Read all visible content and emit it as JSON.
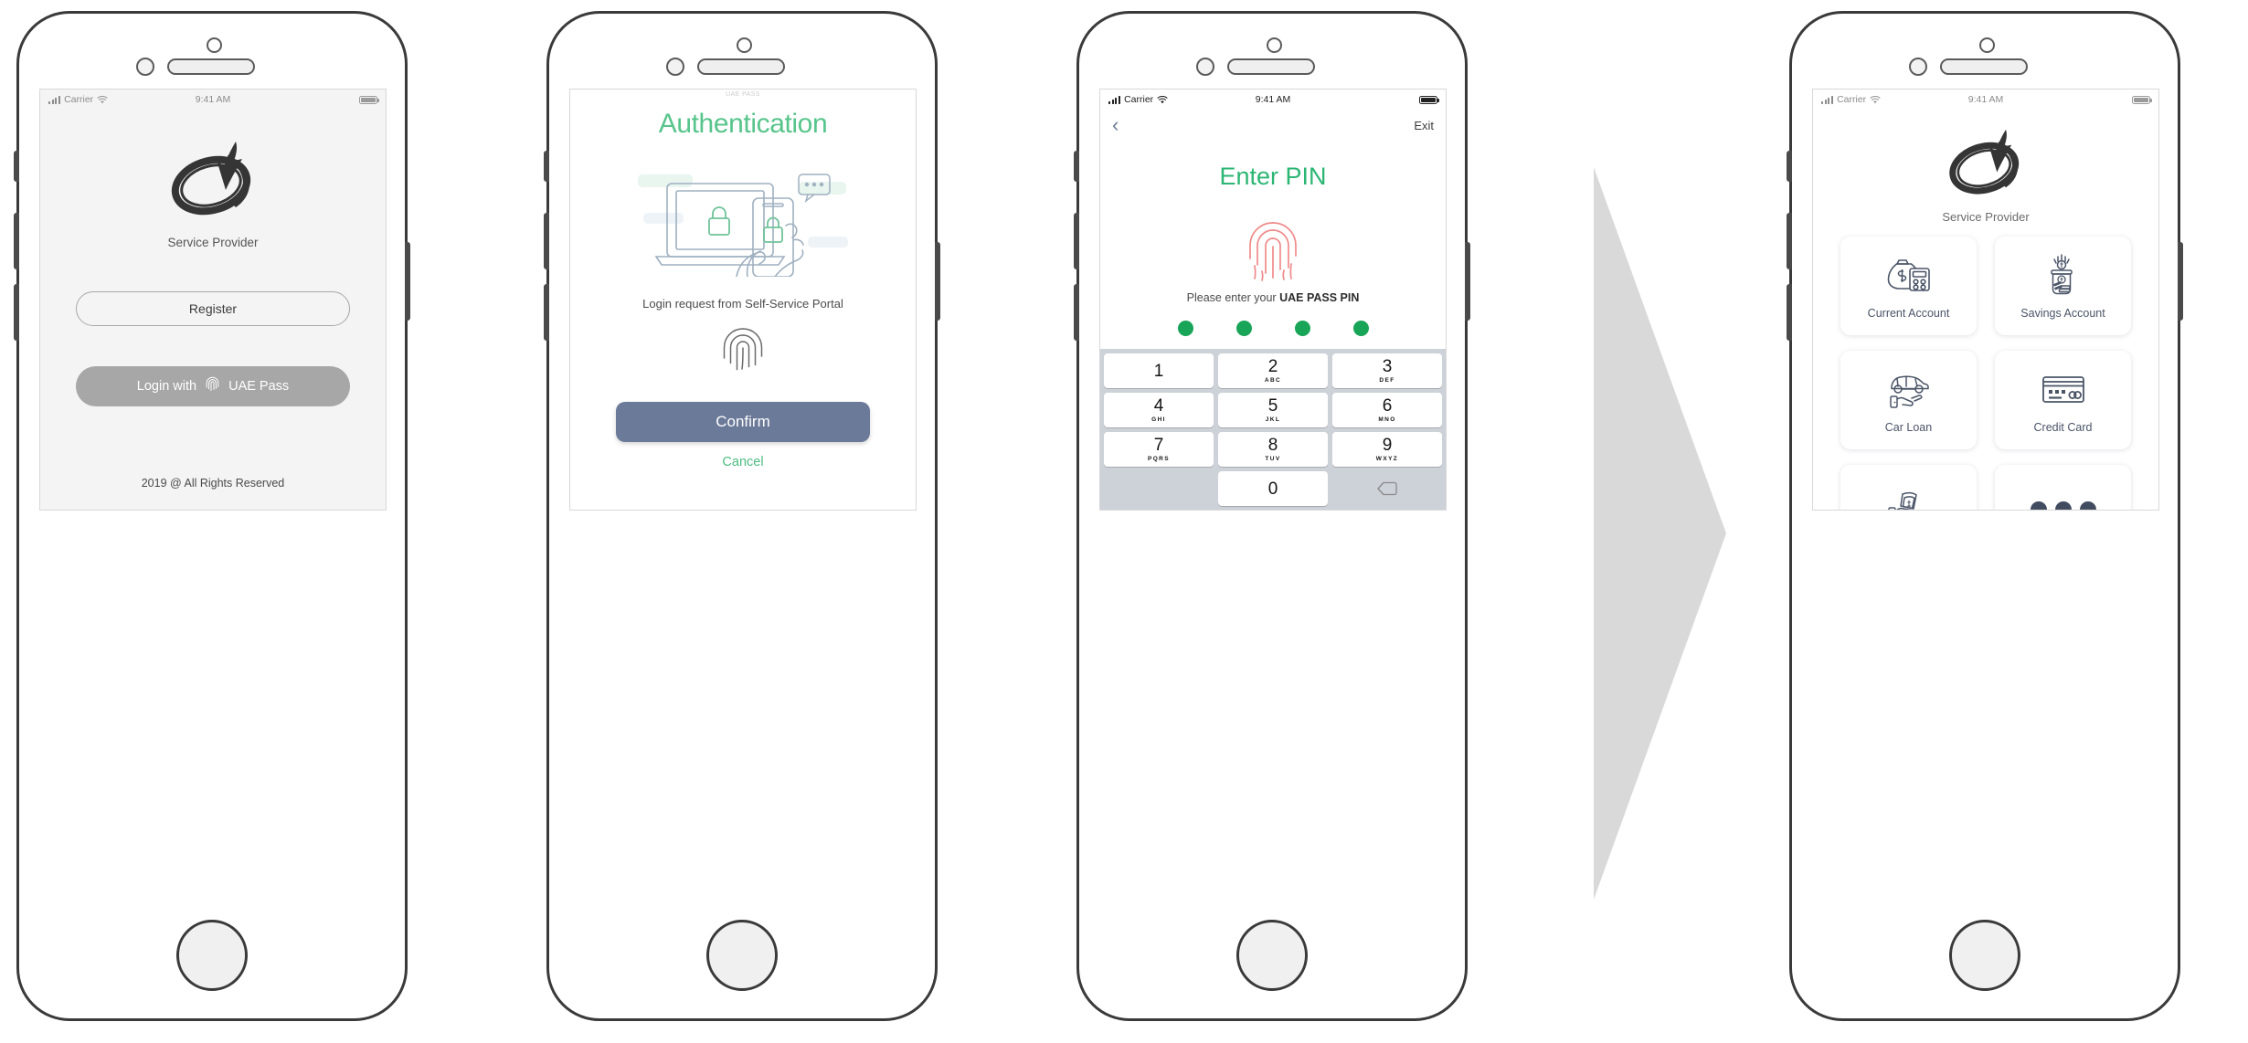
{
  "brand": {
    "name": "Service Provider",
    "logo_icon": "swoosh-logo-icon"
  },
  "colors": {
    "green": "#2bb673",
    "green_title": "#57c58b",
    "confirm_blue": "#6b7a99",
    "uaepass_gray": "#a7a7a7",
    "tile_icon": "#4b5568",
    "arrow_gray": "#d9d9d9",
    "fingerprint_red": "#ef8a8a",
    "pin_dot_green": "#18a558"
  },
  "status_bar": {
    "carrier": "Carrier",
    "time": "9:41 AM",
    "signal_icon": "signal-bars-icon",
    "wifi_icon": "wifi-icon",
    "battery_icon": "battery-icon"
  },
  "screen1": {
    "name": "splash-login",
    "brand_label": "Service Provider",
    "register_label": "Register",
    "uaepass_prefix": "Login with",
    "uaepass_suffix": "UAE Pass",
    "uaepass_icon": "fingerprint-icon",
    "copyright": "2019 @ All Rights Reserved"
  },
  "screen2": {
    "name": "authentication",
    "watermark": "UAE PASS",
    "title": "Authentication",
    "illustration_icon": "laptop-phone-lock-illustration",
    "request_text": "Login request from Self-Service Portal",
    "fingerprint_icon": "fingerprint-icon",
    "confirm_label": "Confirm",
    "cancel_label": "Cancel"
  },
  "screen3": {
    "name": "enter-pin",
    "back_icon": "chevron-left-icon",
    "exit_label": "Exit",
    "title": "Enter PIN",
    "fingerprint_icon": "fingerprint-icon",
    "prompt_prefix": "Please enter your ",
    "prompt_bold": "UAE PASS PIN",
    "pin_filled_count": 4,
    "pin_length": 4,
    "keypad": [
      {
        "num": "1",
        "sub": ""
      },
      {
        "num": "2",
        "sub": "ABC"
      },
      {
        "num": "3",
        "sub": "DEF"
      },
      {
        "num": "4",
        "sub": "GHI"
      },
      {
        "num": "5",
        "sub": "JKL"
      },
      {
        "num": "6",
        "sub": "MNO"
      },
      {
        "num": "7",
        "sub": "PQRS"
      },
      {
        "num": "8",
        "sub": "TUV"
      },
      {
        "num": "9",
        "sub": "WXYZ"
      },
      {
        "num": "0",
        "sub": ""
      }
    ],
    "delete_icon": "backspace-icon"
  },
  "screen4": {
    "name": "service-dashboard",
    "brand_label": "Service Provider",
    "tiles": [
      {
        "label": "Current Account",
        "icon": "money-bag-calculator-icon"
      },
      {
        "label": "Savings Account",
        "icon": "savings-jar-icon"
      },
      {
        "label": "Car Loan",
        "icon": "car-handshake-icon"
      },
      {
        "label": "Credit Card",
        "icon": "credit-card-icon"
      },
      {
        "label": "",
        "icon": "hand-cash-icon"
      },
      {
        "label": "",
        "icon": "more-dots-icon"
      }
    ]
  },
  "flow_arrow": {
    "icon": "right-triangle-arrow-icon"
  }
}
